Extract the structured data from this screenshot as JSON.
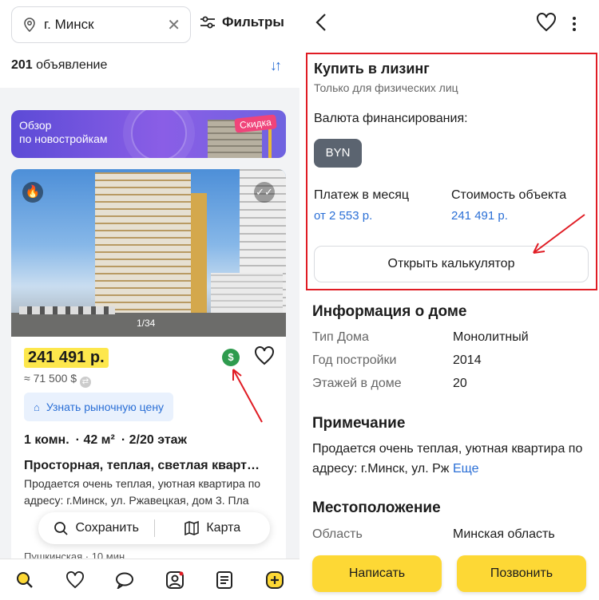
{
  "left": {
    "search": {
      "city": "г. Минск"
    },
    "filters_label": "Фильтры",
    "count_num": "201",
    "count_text": "объявление",
    "banner": {
      "line1": "Обзор",
      "line2": "по новостройкам",
      "badge": "Скидка"
    },
    "card": {
      "pager": "1/34",
      "price": "241 491 р.",
      "usd": "≈ 71 500 $",
      "market_label": "Узнать рыночную цену",
      "params": [
        "1 комн.",
        "42 м²",
        "2/20 этаж"
      ],
      "title": "Просторная, теплая, светлая кварт…",
      "desc": "Продается очень теплая, уютная квартира по адресу: г.Минск, ул. Ржавецкая, дом 3. Пла",
      "save_label": "Сохранить",
      "map_label": "Карта",
      "metro": "Пушкинская · 10 мин"
    },
    "tabbar": [
      "search-icon",
      "heart-icon",
      "chat-icon",
      "profile-icon",
      "list-icon",
      "add-icon"
    ]
  },
  "right": {
    "lease": {
      "title": "Купить в лизинг",
      "subtitle": "Только для физических лиц",
      "currency_label": "Валюта финансирования:",
      "currency": "BYN",
      "monthly_label": "Платеж в месяц",
      "monthly_value": "от 2 553 р.",
      "cost_label": "Стоимость объекта",
      "cost_value": "241 491 р.",
      "calc_label": "Открыть калькулятор"
    },
    "house": {
      "title": "Информация о доме",
      "rows": [
        {
          "k": "Тип Дома",
          "v": "Монолитный"
        },
        {
          "k": "Год постройки",
          "v": "2014"
        },
        {
          "k": "Этажей в доме",
          "v": "20"
        }
      ]
    },
    "note": {
      "title": "Примечание",
      "text": "Продается очень теплая, уютная квартира по адресу: г.Минск, ул. Рж",
      "more": "Еще"
    },
    "location": {
      "title": "Местоположение",
      "region_label": "Область",
      "region_value": "Минская область"
    },
    "write_label": "Написать",
    "call_label": "Позвонить"
  },
  "colors": {
    "accent": "#fdd835",
    "link": "#2a6fd6",
    "highlight": "#e01c24"
  }
}
